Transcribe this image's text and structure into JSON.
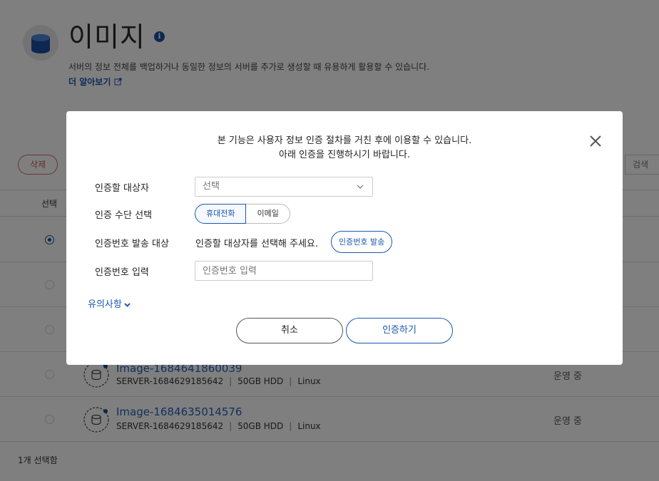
{
  "page": {
    "title": "이미지",
    "description": "서버의 정보 전체를 백업하거나 동일한 정보의 서버를 추가로 생성할 때 유용하게 활용할 수 있습니다.",
    "learn_more": "더 알아보기",
    "delete_label": "삭제",
    "search_label": "검색",
    "table_header_select": "선택",
    "selected_count": "1개 선택함",
    "rows": [
      {
        "name": "Image-1684641860039",
        "server": "SERVER-1684629185642",
        "disk": "50GB HDD",
        "os": "Linux",
        "status": "운영 중"
      },
      {
        "name": "Image-1684635014576",
        "server": "SERVER-1684629185642",
        "disk": "50GB HDD",
        "os": "Linux",
        "status": "운영 중"
      }
    ],
    "meta_separator": "|"
  },
  "modal": {
    "message_line1": "본 기능은 사용자 정보 인증 절차를 거친 후에 이용할 수 있습니다.",
    "message_line2": "아래 인증을 진행하시기 바랍니다.",
    "target_label": "인증할 대상자",
    "target_value": "선택",
    "method_label": "인증 수단 선택",
    "method_options": [
      "휴대전화",
      "이메일"
    ],
    "send_target_label": "인증번호 발송 대상",
    "send_target_value": "인증할 대상자를 선택해 주세요.",
    "send_button": "인증번호 발송",
    "code_label": "인증번호 입력",
    "code_placeholder": "인증번호 입력",
    "notice_toggle": "유의사항",
    "cancel_button": "취소",
    "confirm_button": "인증하기"
  },
  "colors": {
    "accent": "#1a56b0",
    "danger": "#d05a5a",
    "overlay": "rgba(0,0,0,0.5)"
  }
}
